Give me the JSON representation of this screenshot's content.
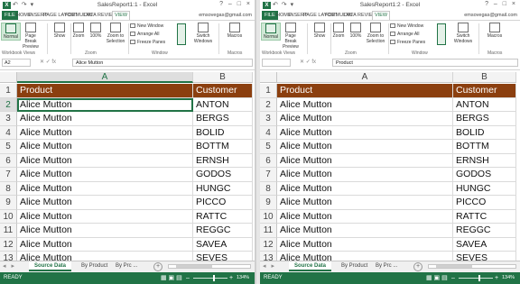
{
  "windows": [
    {
      "title": "SalesReport1:1 - Excel",
      "user": "emsovegas@gmail.com",
      "tabs": [
        "FILE",
        "HOME",
        "INSERT",
        "PAGE LAYOUT",
        "FORMULAS",
        "DATA",
        "REVIEW",
        "VIEW"
      ],
      "active_tab": "VIEW",
      "ribbon": {
        "normal": "Normal",
        "page_break": "Page Break Preview",
        "show": "Show",
        "zoom": "Zoom",
        "zoom100": "100%",
        "zoom_selection": "Zoom to Selection",
        "new_window": "New Window",
        "arrange_all": "Arrange All",
        "freeze_panes": "Freeze Panes",
        "switch_windows": "Switch Windows",
        "macros": "Macros",
        "groups": [
          "Workbook Views",
          "Zoom",
          "Window",
          "Macros"
        ]
      },
      "name_box": "A2",
      "formula": "Alice Mutton",
      "columns": [
        "A",
        "B"
      ],
      "selected_column": "A",
      "rows": [
        {
          "n": "1",
          "a": "Product",
          "b": "Customer"
        },
        {
          "n": "2",
          "a": "Alice Mutton",
          "b": "ANTON"
        },
        {
          "n": "3",
          "a": "Alice Mutton",
          "b": "BERGS"
        },
        {
          "n": "4",
          "a": "Alice Mutton",
          "b": "BOLID"
        },
        {
          "n": "5",
          "a": "Alice Mutton",
          "b": "BOTTM"
        },
        {
          "n": "6",
          "a": "Alice Mutton",
          "b": "ERNSH"
        },
        {
          "n": "7",
          "a": "Alice Mutton",
          "b": "GODOS"
        },
        {
          "n": "8",
          "a": "Alice Mutton",
          "b": "HUNGC"
        },
        {
          "n": "9",
          "a": "Alice Mutton",
          "b": "PICCO"
        },
        {
          "n": "10",
          "a": "Alice Mutton",
          "b": "RATTC"
        },
        {
          "n": "11",
          "a": "Alice Mutton",
          "b": "REGGC"
        },
        {
          "n": "12",
          "a": "Alice Mutton",
          "b": "SAVEA"
        },
        {
          "n": "13",
          "a": "Alice Mutton",
          "b": "SEVES"
        }
      ],
      "active_row": "2",
      "sheets": [
        "Source Data",
        "By Product",
        "By Prc ..."
      ],
      "active_sheet": "Source Data",
      "status": "READY",
      "zoom": "134%"
    },
    {
      "title": "SalesReport1:2 - Excel",
      "user": "emsovegas@gmail.com",
      "tabs": [
        "FILE",
        "HOME",
        "INSERT",
        "PAGE LAYOUT",
        "FORMULAS",
        "DATA",
        "REVIEW",
        "VIEW"
      ],
      "active_tab": "VIEW",
      "ribbon": {
        "normal": "Normal",
        "page_break": "Page Break Preview",
        "show": "Show",
        "zoom": "Zoom",
        "zoom100": "100%",
        "zoom_selection": "Zoom to Selection",
        "new_window": "New Window",
        "arrange_all": "Arrange All",
        "freeze_panes": "Freeze Panes",
        "switch_windows": "Switch Windows",
        "macros": "Macros",
        "groups": [
          "Workbook Views",
          "Zoom",
          "Window",
          "Macros"
        ]
      },
      "name_box": "",
      "formula": "Product",
      "columns": [
        "A",
        "B"
      ],
      "selected_column": "",
      "rows": [
        {
          "n": "1",
          "a": "Product",
          "b": "Customer"
        },
        {
          "n": "2",
          "a": "Alice Mutton",
          "b": "ANTON"
        },
        {
          "n": "3",
          "a": "Alice Mutton",
          "b": "BERGS"
        },
        {
          "n": "4",
          "a": "Alice Mutton",
          "b": "BOLID"
        },
        {
          "n": "5",
          "a": "Alice Mutton",
          "b": "BOTTM"
        },
        {
          "n": "6",
          "a": "Alice Mutton",
          "b": "ERNSH"
        },
        {
          "n": "7",
          "a": "Alice Mutton",
          "b": "GODOS"
        },
        {
          "n": "8",
          "a": "Alice Mutton",
          "b": "HUNGC"
        },
        {
          "n": "9",
          "a": "Alice Mutton",
          "b": "PICCO"
        },
        {
          "n": "10",
          "a": "Alice Mutton",
          "b": "RATTC"
        },
        {
          "n": "11",
          "a": "Alice Mutton",
          "b": "REGGC"
        },
        {
          "n": "12",
          "a": "Alice Mutton",
          "b": "SAVEA"
        },
        {
          "n": "13",
          "a": "Alice Mutton",
          "b": "SEVES"
        }
      ],
      "active_row": "",
      "sheets": [
        "Source Data",
        "By Product",
        "By Prc ..."
      ],
      "active_sheet": "Source Data",
      "status": "READY",
      "zoom": "134%"
    }
  ],
  "colors": {
    "excel_green": "#217346",
    "header_fill": "#8b3f0f",
    "header_text": "#ffffff"
  },
  "icons": {
    "app": "excel-logo-icon",
    "zoom": "magnifier-icon",
    "add_sheet": "plus-circle-icon"
  }
}
